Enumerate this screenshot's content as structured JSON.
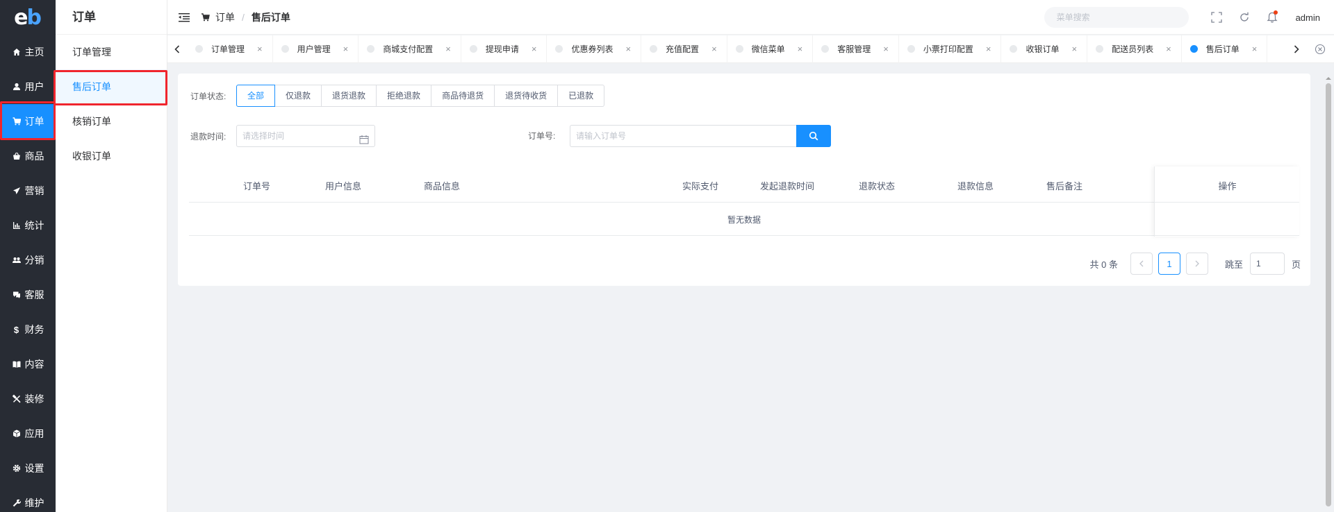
{
  "logo": {
    "part1": "e",
    "part2": "b"
  },
  "rail": [
    {
      "label": "主页",
      "icon": "home-icon"
    },
    {
      "label": "用户",
      "icon": "user-icon"
    },
    {
      "label": "订单",
      "icon": "cart-icon"
    },
    {
      "label": "商品",
      "icon": "basket-icon"
    },
    {
      "label": "营销",
      "icon": "send-icon"
    },
    {
      "label": "统计",
      "icon": "bar-chart-icon"
    },
    {
      "label": "分销",
      "icon": "group-icon"
    },
    {
      "label": "客服",
      "icon": "chat-icon"
    },
    {
      "label": "财务",
      "icon": "dollar-icon"
    },
    {
      "label": "内容",
      "icon": "book-icon"
    },
    {
      "label": "装修",
      "icon": "tools-icon"
    },
    {
      "label": "应用",
      "icon": "cube-icon"
    },
    {
      "label": "设置",
      "icon": "gear-icon"
    },
    {
      "label": "维护",
      "icon": "wrench-icon"
    }
  ],
  "submenu": {
    "title": "订单",
    "items": [
      "订单管理",
      "售后订单",
      "核销订单",
      "收银订单"
    ]
  },
  "header": {
    "breadcrumb_parent": "订单",
    "breadcrumb_sep": "/",
    "breadcrumb_current": "售后订单",
    "search_placeholder": "菜单搜索",
    "user": "admin"
  },
  "tabs": [
    {
      "label": "订单管理",
      "close": "×"
    },
    {
      "label": "用户管理",
      "close": "×"
    },
    {
      "label": "商城支付配置",
      "close": "×"
    },
    {
      "label": "提现申请",
      "close": "×"
    },
    {
      "label": "优惠券列表",
      "close": "×"
    },
    {
      "label": "充值配置",
      "close": "×"
    },
    {
      "label": "微信菜单",
      "close": "×"
    },
    {
      "label": "客服管理",
      "close": "×"
    },
    {
      "label": "小票打印配置",
      "close": "×"
    },
    {
      "label": "收银订单",
      "close": "×"
    },
    {
      "label": "配送员列表",
      "close": "×"
    },
    {
      "label": "售后订单",
      "close": "×"
    }
  ],
  "filters": {
    "status_label": "订单状态:",
    "status_options": [
      "全部",
      "仅退款",
      "退货退款",
      "拒绝退款",
      "商品待退货",
      "退货待收货",
      "已退款"
    ],
    "time_label": "退款时间:",
    "time_placeholder": "请选择时间",
    "order_label": "订单号:",
    "order_placeholder": "请输入订单号"
  },
  "table": {
    "columns": [
      "订单号",
      "用户信息",
      "商品信息",
      "实际支付",
      "发起退款时间",
      "退款状态",
      "退款信息",
      "售后备注"
    ],
    "fixed_column": "操作",
    "empty_text": "暂无数据"
  },
  "pagination": {
    "total_text": "共 0 条",
    "current_page": "1",
    "jump_label": "跳至",
    "jump_value": "1",
    "page_suffix": "页"
  }
}
